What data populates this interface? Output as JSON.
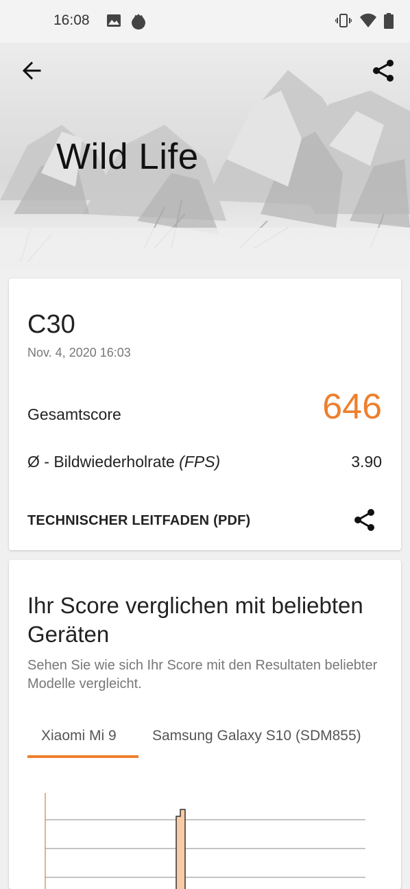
{
  "status_bar": {
    "time": "16:08",
    "left_icons": [
      "image-icon",
      "flame-icon"
    ],
    "right_icons": [
      "vibrate-icon",
      "wifi-icon",
      "battery-icon"
    ]
  },
  "header": {
    "title": "Wild Life",
    "back_icon": "arrow-left-icon",
    "share_icon": "share-icon"
  },
  "result": {
    "device": "C30",
    "date": "Nov. 4, 2020 16:03",
    "score_label": "Gesamtscore",
    "score_value": "646",
    "fps_label_prefix": "Ø - Bildwiederholrate ",
    "fps_label_unit": "(FPS)",
    "fps_value": "3.90",
    "tech_link": "TECHNISCHER LEITFADEN (PDF)",
    "share_icon": "share-icon"
  },
  "comparison": {
    "title": "Ihr Score verglichen mit beliebten Geräten",
    "description": "Sehen Sie wie sich Ihr Score mit den Resultaten beliebter Modelle vergleicht.",
    "tabs": [
      {
        "label": "Xiaomi Mi 9",
        "selected": true
      },
      {
        "label": "Samsung Galaxy S10 (SDM855)",
        "selected": false
      }
    ]
  },
  "colors": {
    "accent": "#ee7f2d",
    "bar_fill": "#f7cba5",
    "bar_stroke": "#333333"
  }
}
